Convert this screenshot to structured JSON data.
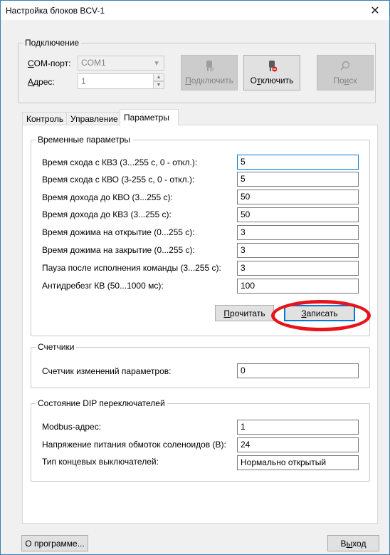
{
  "window": {
    "title": "Настройка блоков BCV-1",
    "close_glyph": "✕"
  },
  "connection": {
    "group_label": "Подключение",
    "com_port_label_u": "C",
    "com_port_label_rest": "OM-порт:",
    "com_port_value": "COM1",
    "address_label_u": "А",
    "address_label_rest": "дрес:",
    "address_value": "1",
    "connect_label_u": "П",
    "connect_label_rest": "одключить",
    "disconnect_label_pre": "О",
    "disconnect_label_u": "т",
    "disconnect_label_rest": "ключить",
    "search_label_pre": "По",
    "search_label_u": "и",
    "search_label_rest": "ск"
  },
  "tabs": [
    {
      "label": "Контроль"
    },
    {
      "label": "Управление"
    },
    {
      "label": "Параметры"
    }
  ],
  "time_params": {
    "group_label": "Временные параметры",
    "rows": [
      {
        "label": "Время схода с КВЗ (3...255 с, 0 - откл.):",
        "value": "5"
      },
      {
        "label": "Время схода с КВО (3-255 с, 0 - откл.):",
        "value": "5"
      },
      {
        "label": "Время дохода до КВО (3...255 с):",
        "value": "50"
      },
      {
        "label": "Время дохода до КВЗ (3...255 с):",
        "value": "50"
      },
      {
        "label": "Время дожима на открытие (0...255 с):",
        "value": "3"
      },
      {
        "label": "Время дожима на закрытие (0...255 с):",
        "value": "3"
      },
      {
        "label": "Пауза после исполнения команды (3...255 с):",
        "value": "3"
      },
      {
        "label": "Антидребезг КВ (50...1000 мс):",
        "value": "100"
      }
    ],
    "read_label_u": "П",
    "read_label_rest": "рочитать",
    "write_label_u": "З",
    "write_label_rest": "аписать"
  },
  "counters": {
    "group_label": "Счетчики",
    "label": "Счетчик изменений параметров:",
    "value": "0"
  },
  "dip": {
    "group_label": "Состояние DIP переключателей",
    "rows": [
      {
        "label": "Modbus-адрес:",
        "value": "1"
      },
      {
        "label": "Напряжение питания обмоток соленоидов (В):",
        "value": "24"
      },
      {
        "label": "Тип концевых выключателей:",
        "value": "Нормально открытый"
      }
    ]
  },
  "footer": {
    "about_label": "О программе...",
    "exit_label_pre": "В",
    "exit_label_u": "ы",
    "exit_label_rest": "ход"
  },
  "colors": {
    "accent": "#0078d7",
    "highlight_ellipse": "#e8141c",
    "window_border": "#3c7fb1"
  }
}
